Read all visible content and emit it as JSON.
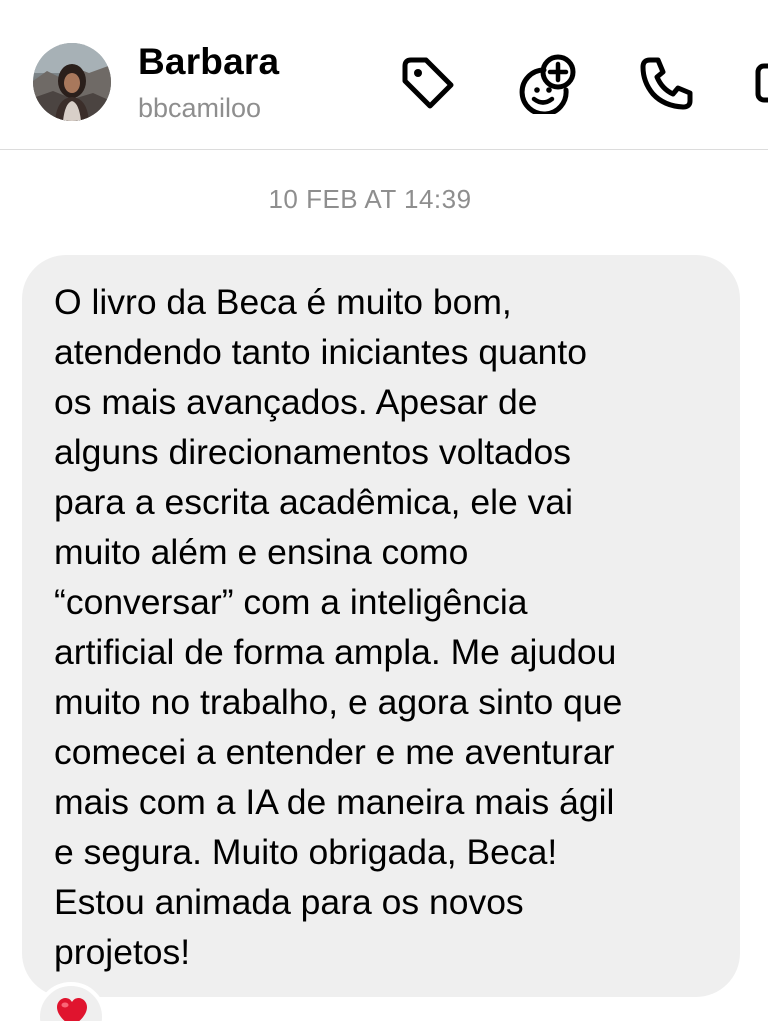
{
  "header": {
    "name": "Barbara",
    "handle": "bbcamiloo",
    "icons": [
      "tag-icon",
      "add-sticker-icon",
      "phone-icon",
      "video-icon"
    ]
  },
  "conversation": {
    "timestamp": "10 FEB AT 14:39",
    "message_lines": [
      "O livro da Beca é muito bom,",
      "atendendo tanto iniciantes quanto",
      "os mais avançados. Apesar de",
      "alguns direcionamentos voltados",
      "para a escrita acadêmica, ele vai",
      "muito além e ensina como",
      "“conversar” com a inteligência",
      "artificial de forma ampla. Me ajudou",
      "muito no trabalho, e agora sinto que",
      "comecei a entender e me aventurar",
      "mais com a IA de maneira mais ágil",
      "e segura. Muito obrigada, Beca!",
      "Estou animada para os novos",
      "projetos!"
    ],
    "reaction": "heart-emoji"
  },
  "colors": {
    "bubble": "#efefef",
    "secondary_text": "#8e8e8e",
    "divider": "#dcdcdc",
    "heart": "#e0142e"
  }
}
